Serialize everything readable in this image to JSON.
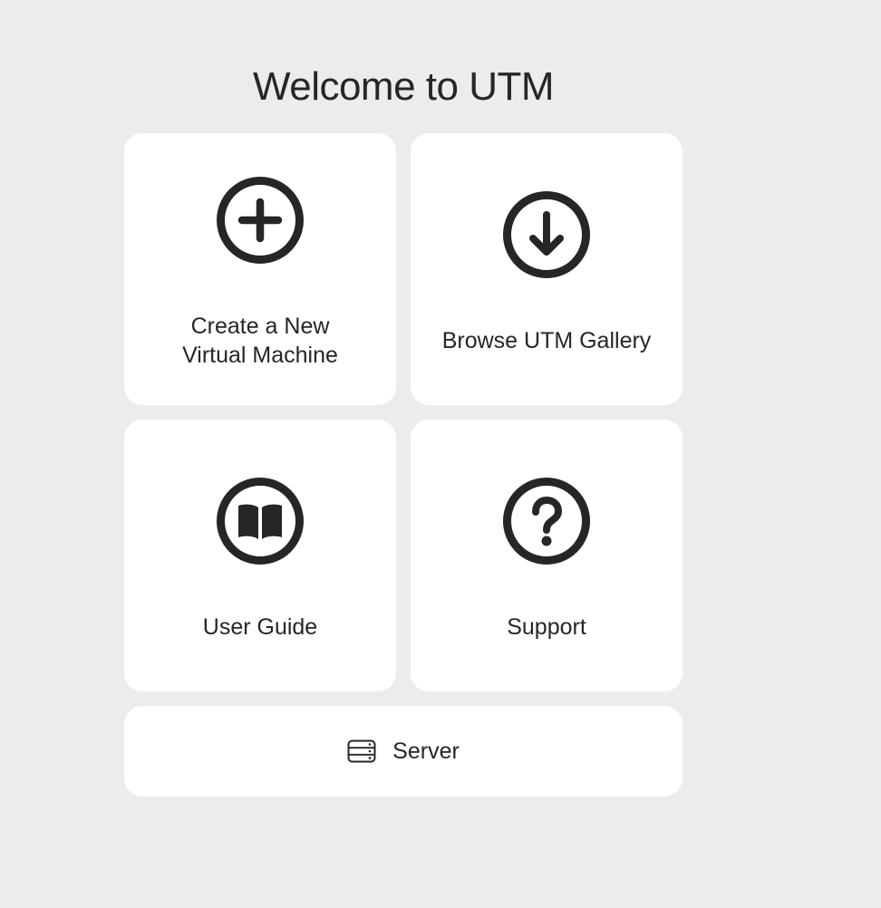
{
  "welcome": {
    "title": "Welcome to UTM"
  },
  "actions": {
    "create_vm": {
      "label_line1": "Create a New",
      "label_line2": "Virtual Machine",
      "icon": "plus-circle-icon"
    },
    "browse_gallery": {
      "label": "Browse UTM Gallery",
      "icon": "download-circle-icon"
    },
    "user_guide": {
      "label": "User Guide",
      "icon": "book-circle-icon"
    },
    "support": {
      "label": "Support",
      "icon": "question-circle-icon"
    },
    "server": {
      "label": "Server",
      "icon": "server-icon"
    }
  },
  "colors": {
    "background": "#ececec",
    "card": "#ffffff",
    "foreground": "#262626"
  }
}
